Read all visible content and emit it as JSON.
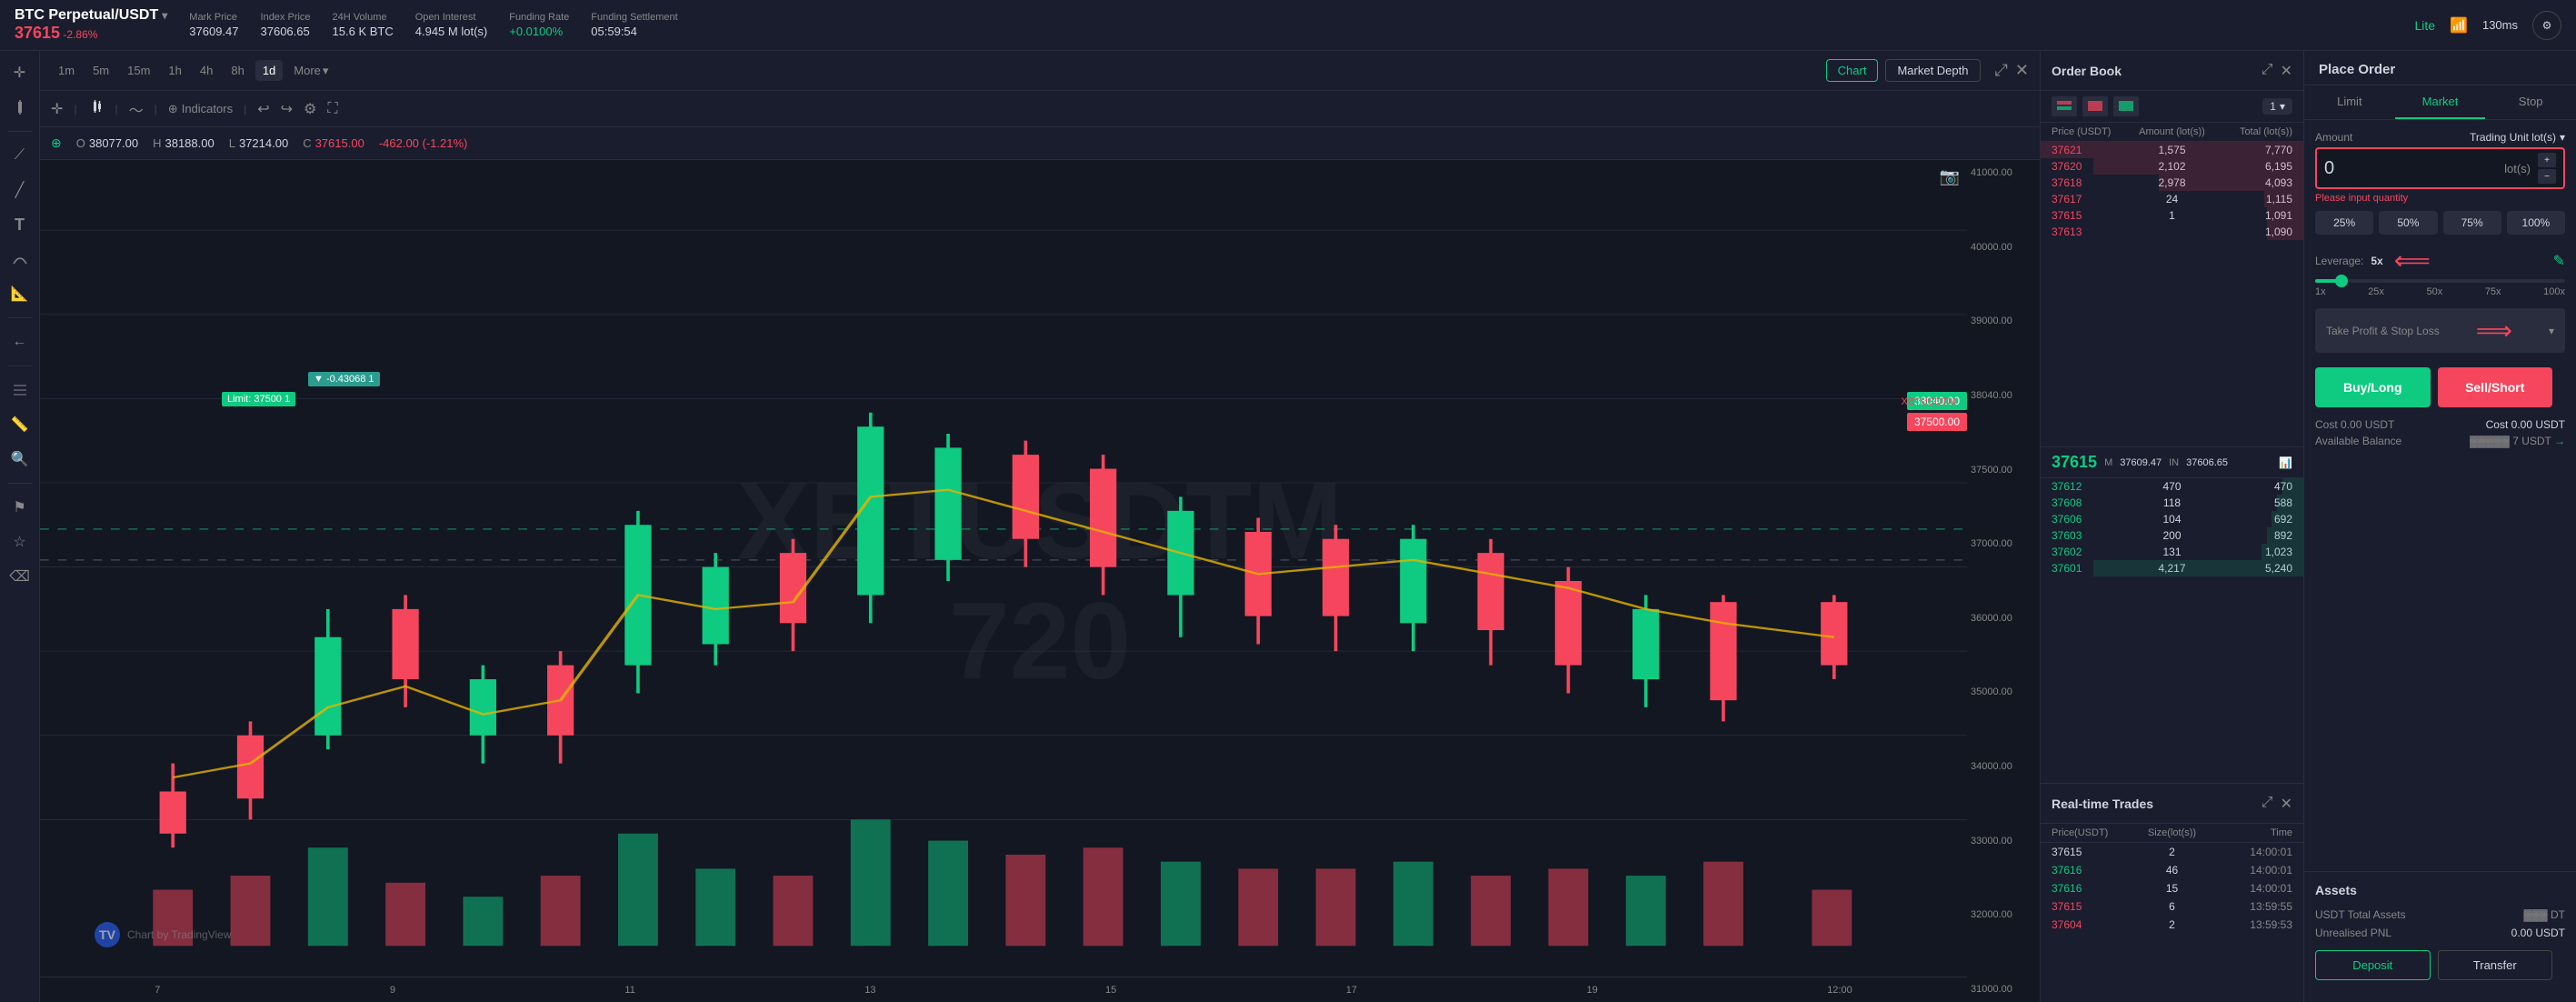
{
  "topbar": {
    "symbol": "BTC Perpetual/USDT",
    "dropdown_icon": "▾",
    "price": "37615",
    "change": "-2.86%",
    "stats": [
      {
        "label": "Mark Price",
        "value": "37609.47",
        "class": ""
      },
      {
        "label": "Index Price",
        "value": "37606.65",
        "class": ""
      },
      {
        "label": "24H Volume",
        "value": "15.6 K BTC",
        "class": ""
      },
      {
        "label": "Open Interest",
        "value": "4.945 M lot(s)",
        "class": ""
      },
      {
        "label": "Funding Rate",
        "value": "+0.0100%",
        "class": "green"
      },
      {
        "label": "Funding Settlement",
        "value": "05:59:54",
        "class": ""
      }
    ],
    "lite": "Lite",
    "ping": "130ms"
  },
  "timeframes": {
    "items": [
      "1m",
      "5m",
      "15m",
      "1h",
      "4h",
      "8h",
      "1d"
    ],
    "more": "More",
    "active": "1d",
    "chart_btn": "Chart",
    "market_depth_btn": "Market Depth"
  },
  "chart_toolbar": {
    "indicators": "Indicators"
  },
  "ohlc": {
    "o_label": "O",
    "o_value": "38077.00",
    "h_label": "H",
    "h_value": "38188.00",
    "l_label": "L",
    "l_value": "37214.00",
    "c_label": "C",
    "c_value": "37615.00",
    "change": "-462.00 (-1.21%)"
  },
  "chart": {
    "watermark_line1": "XBTUSDTM",
    "watermark_line2": "720",
    "price_levels": [
      "41000.00",
      "40000.00",
      "39000.00",
      "38040.00",
      "37500.00",
      "37000.00",
      "36000.00",
      "35000.00",
      "34000.00",
      "33000.00",
      "32000.00",
      "31000.00"
    ],
    "dates": [
      "7",
      "9",
      "11",
      "13",
      "15",
      "17",
      "19"
    ],
    "logo_text": "Chart by TradingView",
    "limit_label": "▼ -0.43068  1",
    "limit_price": "Limit: 37500  1",
    "marker_green": "38040.00",
    "marker_red": "37500.00",
    "xbtusdtm_label": "XBTUSDTM",
    "time_label": "12:00"
  },
  "order_book": {
    "title": "Order Book",
    "col_price": "Price (USDT)",
    "col_amount": "Amount (lot(s))",
    "col_total": "Total (lot(s))",
    "asks": [
      {
        "price": "37621",
        "amount": "1,575",
        "total": "7,770"
      },
      {
        "price": "37620",
        "amount": "2,102",
        "total": "6,195"
      },
      {
        "price": "37618",
        "amount": "2,978",
        "total": "4,093"
      },
      {
        "price": "37617",
        "amount": "24",
        "total": "1,115"
      },
      {
        "price": "37615",
        "amount": "1",
        "total": "1,091"
      },
      {
        "price": "37613",
        "amount": "",
        "total": "1,090"
      }
    ],
    "mid_price": "37615",
    "mid_mark_label": "M",
    "mid_mark_val": "37609.47",
    "mid_index_label": "IN",
    "mid_index_val": "37606.65",
    "bids": [
      {
        "price": "37612",
        "amount": "470",
        "total": "470"
      },
      {
        "price": "37608",
        "amount": "118",
        "total": "588"
      },
      {
        "price": "37606",
        "amount": "104",
        "total": "692"
      },
      {
        "price": "37603",
        "amount": "200",
        "total": "892"
      },
      {
        "price": "37602",
        "amount": "131",
        "total": "1,023"
      },
      {
        "price": "37601",
        "amount": "4,217",
        "total": "5,240"
      }
    ]
  },
  "rt_trades": {
    "title": "Real-time Trades",
    "col_price": "Price(USDT)",
    "col_size": "Size(lot(s))",
    "col_time": "Time",
    "rows": [
      {
        "price": "37615",
        "size": "2",
        "time": "14:00:01",
        "side": "bid"
      },
      {
        "price": "37616",
        "size": "46",
        "time": "14:00:01",
        "side": "ask"
      },
      {
        "price": "37616",
        "size": "15",
        "time": "14:00:01",
        "side": "ask"
      },
      {
        "price": "37615",
        "size": "6",
        "time": "13:59:55",
        "side": "bid"
      },
      {
        "price": "37604",
        "size": "2",
        "time": "13:59:53",
        "side": "bid"
      }
    ]
  },
  "place_order": {
    "title": "Place Order",
    "tabs": [
      "Limit",
      "Market",
      "Stop"
    ],
    "active_tab": "Market",
    "amount_label": "Amount",
    "trading_unit": "Trading Unit lot(s)",
    "input_value": "0",
    "input_unit": "lot(s)",
    "error_msg": "Please input quantity",
    "pct_btns": [
      "25%",
      "50%",
      "75%",
      "100%"
    ],
    "leverage_label": "Leverage: ",
    "leverage_val": "5x",
    "slider_marks": [
      "1x",
      "25x",
      "50x",
      "75x",
      "100x"
    ],
    "tp_sl_label": "Take Profit & Stop Loss",
    "buy_btn": "Buy/Long",
    "sell_btn": "Sell/Short",
    "cost_label_left": "Cost",
    "cost_val_left": "0.00 USDT",
    "cost_label_right": "Cost",
    "cost_val_right": "0.00 USDT",
    "avail_label": "Available Balance",
    "avail_val": "...7 USDT",
    "assets_title": "Assets",
    "total_assets_label": "USDT Total Assets",
    "total_assets_val": "...DT",
    "pnl_label": "Unrealised PNL",
    "pnl_val": "0.00 USDT",
    "deposit_btn": "Deposit",
    "transfer_btn": "Transfer"
  }
}
